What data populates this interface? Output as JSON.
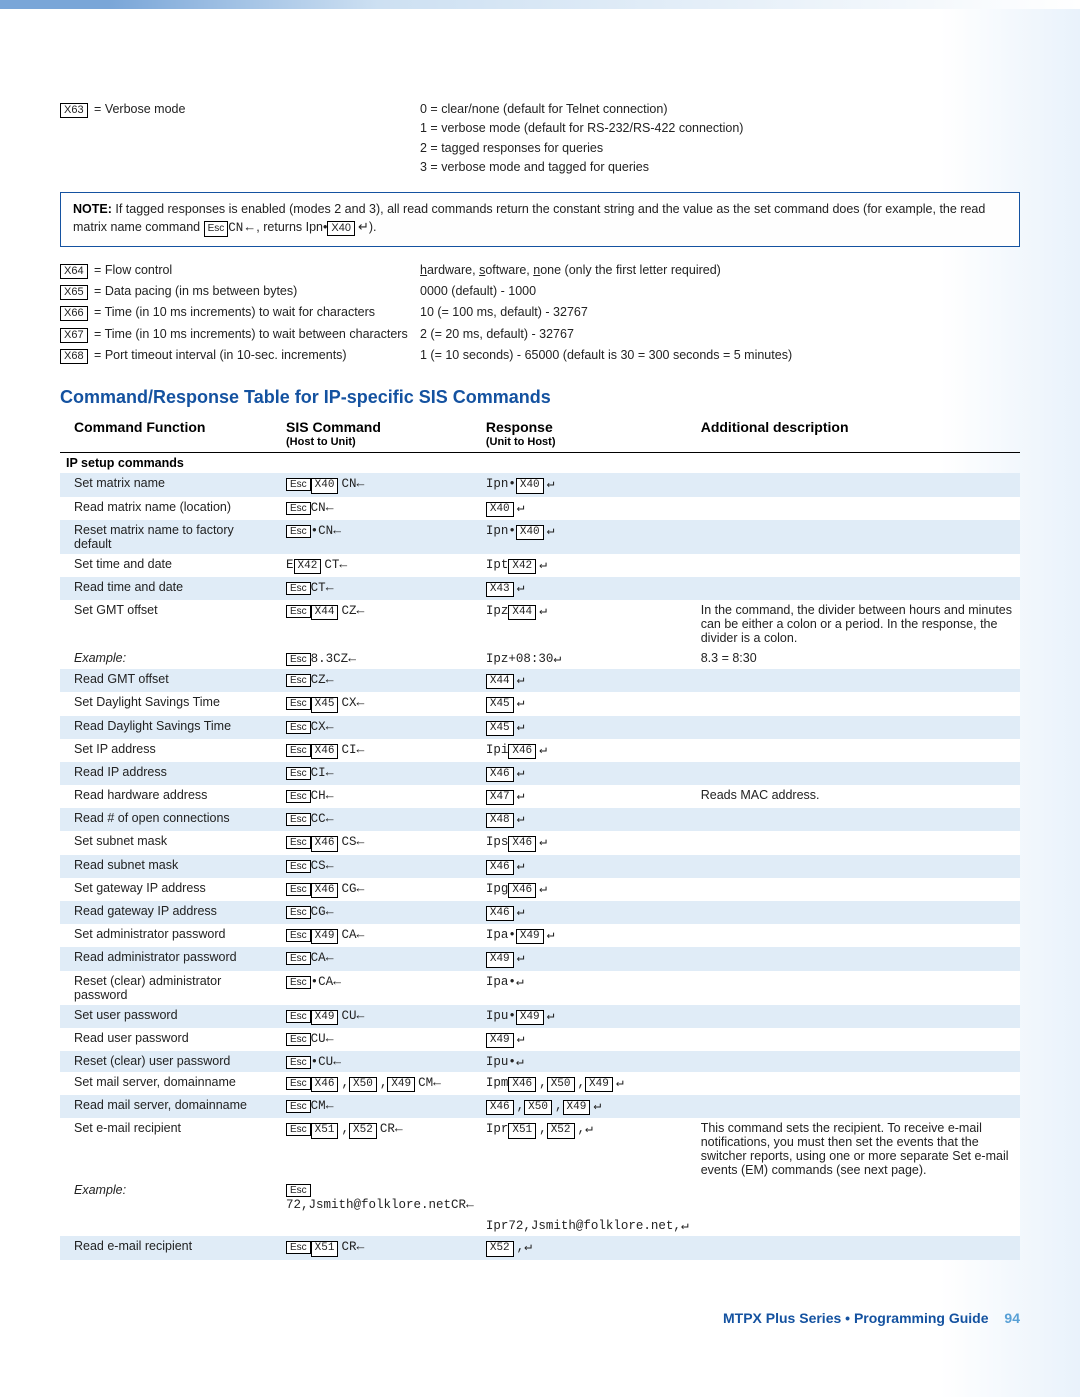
{
  "vars_top": {
    "x63": {
      "code": "X63",
      "label": "Verbose mode",
      "right": [
        "0 = clear/none (default for Telnet connection)",
        "1 = verbose mode (default for RS-232/RS-422 connection)",
        "2 = tagged responses for queries",
        "3 = verbose mode and tagged for queries"
      ]
    }
  },
  "note": {
    "label": "NOTE:",
    "prefix": "If tagged responses is enabled (modes 2 and 3), all read commands return the constant string and the value as the set command does (for example, the read matrix name command ",
    "mid_cmd": "CN",
    "mid2": ", returns Ipn•",
    "x40": "X40",
    "suffix": ")."
  },
  "vars_bottom": [
    {
      "code": "X64",
      "label": "Flow control",
      "right": "hardware, software, none (only the first letter required)",
      "uline": [
        "h",
        "s",
        "n"
      ]
    },
    {
      "code": "X65",
      "label": "Data pacing (in ms between bytes)",
      "right": "0000 (default) - 1000"
    },
    {
      "code": "X66",
      "label": "Time (in 10 ms increments) to wait for characters",
      "right": "10 (= 100 ms, default) - 32767"
    },
    {
      "code": "X67",
      "label": "Time (in 10 ms increments) to wait between characters",
      "right": "2 (= 20 ms, default) - 32767"
    },
    {
      "code": "X68",
      "label": "Port timeout interval (in 10-sec. increments)",
      "right": "1 (= 10 seconds) - 65000 (default is 30 = 300 seconds = 5 minutes)"
    }
  ],
  "section_title": "Command/Response Table for IP-specific SIS Commands",
  "headers": {
    "c1": "Command Function",
    "c2": "SIS Command",
    "c2s": "(Host to Unit)",
    "c3": "Response",
    "c3s": "(Unit to Host)",
    "c4": "Additional description"
  },
  "group_header": "IP setup commands",
  "rows": [
    {
      "alt": true,
      "func": "Set matrix name",
      "sis": {
        "parts": [
          {
            "esc": true
          },
          {
            "x": "X40"
          },
          {
            "t": "CN"
          },
          {
            "left": true
          }
        ]
      },
      "resp": {
        "parts": [
          {
            "t": "Ipn•"
          },
          {
            "x": "X40"
          },
          {
            "ent": true
          }
        ]
      },
      "desc": ""
    },
    {
      "alt": false,
      "func": "Read matrix name (location)",
      "sis": {
        "parts": [
          {
            "esc": true
          },
          {
            "t": "CN"
          },
          {
            "left": true
          }
        ]
      },
      "resp": {
        "parts": [
          {
            "x": "X40"
          },
          {
            "ent": true
          }
        ]
      },
      "desc": ""
    },
    {
      "alt": true,
      "func": "Reset matrix name to factory default",
      "sis": {
        "parts": [
          {
            "esc": true
          },
          {
            "t": "•CN"
          },
          {
            "left": true
          }
        ]
      },
      "resp": {
        "parts": [
          {
            "t": "Ipn•"
          },
          {
            "x": "X40"
          },
          {
            "ent": true
          }
        ]
      },
      "desc": ""
    },
    {
      "alt": false,
      "func": "Set time and date",
      "sis": {
        "parts": [
          {
            "t": "E"
          },
          {
            "x": "X42"
          },
          {
            "t": "CT"
          },
          {
            "left": true
          }
        ]
      },
      "resp": {
        "parts": [
          {
            "t": "Ipt"
          },
          {
            "x": "X42"
          },
          {
            "ent": true
          }
        ]
      },
      "desc": ""
    },
    {
      "alt": true,
      "func": "Read time and date",
      "sis": {
        "parts": [
          {
            "esc": true
          },
          {
            "t": "CT"
          },
          {
            "left": true
          }
        ]
      },
      "resp": {
        "parts": [
          {
            "x": "X43"
          },
          {
            "ent": true
          }
        ]
      },
      "desc": ""
    },
    {
      "alt": false,
      "func": "Set GMT offset",
      "sis": {
        "parts": [
          {
            "esc": true
          },
          {
            "x": "X44"
          },
          {
            "t": "CZ"
          },
          {
            "left": true
          }
        ]
      },
      "resp": {
        "parts": [
          {
            "t": "Ipz"
          },
          {
            "x": "X44"
          },
          {
            "ent": true
          }
        ]
      },
      "desc": "In the command, the divider between hours and minutes can be either a colon or a period. In the response, the divider is a colon."
    },
    {
      "alt": false,
      "italic": true,
      "func": "Example:",
      "sis": {
        "parts": [
          {
            "esc": true
          },
          {
            "t": "8.3CZ"
          },
          {
            "left": true
          }
        ]
      },
      "resp": {
        "parts": [
          {
            "t": "Ipz+08:30"
          },
          {
            "ent": true
          }
        ]
      },
      "desc": "8.3 = 8:30"
    },
    {
      "alt": true,
      "func": "Read GMT offset",
      "sis": {
        "parts": [
          {
            "esc": true
          },
          {
            "t": "CZ"
          },
          {
            "left": true
          }
        ]
      },
      "resp": {
        "parts": [
          {
            "x": "X44"
          },
          {
            "ent": true
          }
        ]
      },
      "desc": ""
    },
    {
      "alt": false,
      "func": "Set Daylight Savings Time",
      "sis": {
        "parts": [
          {
            "esc": true
          },
          {
            "x": "X45"
          },
          {
            "t": "CX"
          },
          {
            "left": true
          }
        ]
      },
      "resp": {
        "parts": [
          {
            "x": "X45"
          },
          {
            "ent": true
          }
        ]
      },
      "desc": ""
    },
    {
      "alt": true,
      "func": "Read Daylight Savings Time",
      "sis": {
        "parts": [
          {
            "esc": true
          },
          {
            "t": "CX"
          },
          {
            "left": true
          }
        ]
      },
      "resp": {
        "parts": [
          {
            "x": "X45"
          },
          {
            "ent": true
          }
        ]
      },
      "desc": ""
    },
    {
      "alt": false,
      "func": "Set IP address",
      "sis": {
        "parts": [
          {
            "esc": true
          },
          {
            "x": "X46"
          },
          {
            "t": "CI"
          },
          {
            "left": true
          }
        ]
      },
      "resp": {
        "parts": [
          {
            "t": "Ipi"
          },
          {
            "x": "X46"
          },
          {
            "ent": true
          }
        ]
      },
      "desc": ""
    },
    {
      "alt": true,
      "func": "Read IP address",
      "sis": {
        "parts": [
          {
            "esc": true
          },
          {
            "t": "CI"
          },
          {
            "left": true
          }
        ]
      },
      "resp": {
        "parts": [
          {
            "x": "X46"
          },
          {
            "ent": true
          }
        ]
      },
      "desc": ""
    },
    {
      "alt": false,
      "func": "Read hardware address",
      "sis": {
        "parts": [
          {
            "esc": true
          },
          {
            "t": "CH"
          },
          {
            "left": true
          }
        ]
      },
      "resp": {
        "parts": [
          {
            "x": "X47"
          },
          {
            "ent": true
          }
        ]
      },
      "desc": "Reads MAC address."
    },
    {
      "alt": true,
      "func": "Read # of open connections",
      "sis": {
        "parts": [
          {
            "esc": true
          },
          {
            "t": "CC"
          },
          {
            "left": true
          }
        ]
      },
      "resp": {
        "parts": [
          {
            "x": "X48"
          },
          {
            "ent": true
          }
        ]
      },
      "desc": ""
    },
    {
      "alt": false,
      "func": "Set subnet mask",
      "sis": {
        "parts": [
          {
            "esc": true
          },
          {
            "x": "X46"
          },
          {
            "t": "CS"
          },
          {
            "left": true
          }
        ]
      },
      "resp": {
        "parts": [
          {
            "t": "Ips"
          },
          {
            "x": "X46"
          },
          {
            "ent": true
          }
        ]
      },
      "desc": ""
    },
    {
      "alt": true,
      "func": "Read subnet mask",
      "sis": {
        "parts": [
          {
            "esc": true
          },
          {
            "t": "CS"
          },
          {
            "left": true
          }
        ]
      },
      "resp": {
        "parts": [
          {
            "x": "X46"
          },
          {
            "ent": true
          }
        ]
      },
      "desc": ""
    },
    {
      "alt": false,
      "func": "Set gateway IP address",
      "sis": {
        "parts": [
          {
            "esc": true
          },
          {
            "x": "X46"
          },
          {
            "t": "CG"
          },
          {
            "left": true
          }
        ]
      },
      "resp": {
        "parts": [
          {
            "t": "Ipg"
          },
          {
            "x": "X46"
          },
          {
            "ent": true
          }
        ]
      },
      "desc": ""
    },
    {
      "alt": true,
      "func": "Read gateway IP address",
      "sis": {
        "parts": [
          {
            "esc": true
          },
          {
            "t": "CG"
          },
          {
            "left": true
          }
        ]
      },
      "resp": {
        "parts": [
          {
            "x": "X46"
          },
          {
            "ent": true
          }
        ]
      },
      "desc": ""
    },
    {
      "alt": false,
      "func": "Set administrator password",
      "sis": {
        "parts": [
          {
            "esc": true
          },
          {
            "x": "X49"
          },
          {
            "t": "CA"
          },
          {
            "left": true
          }
        ]
      },
      "resp": {
        "parts": [
          {
            "t": "Ipa•"
          },
          {
            "x": "X49"
          },
          {
            "ent": true
          }
        ]
      },
      "desc": ""
    },
    {
      "alt": true,
      "func": "Read administrator password",
      "sis": {
        "parts": [
          {
            "esc": true
          },
          {
            "t": "CA"
          },
          {
            "left": true
          }
        ]
      },
      "resp": {
        "parts": [
          {
            "x": "X49"
          },
          {
            "ent": true
          }
        ]
      },
      "desc": ""
    },
    {
      "alt": false,
      "func": "Reset (clear) administrator password",
      "sis": {
        "parts": [
          {
            "esc": true
          },
          {
            "t": "•CA"
          },
          {
            "left": true
          }
        ]
      },
      "resp": {
        "parts": [
          {
            "t": "Ipa•"
          },
          {
            "ent": true
          }
        ]
      },
      "desc": ""
    },
    {
      "alt": true,
      "func": "Set user password",
      "sis": {
        "parts": [
          {
            "esc": true
          },
          {
            "x": "X49"
          },
          {
            "t": "CU"
          },
          {
            "left": true
          }
        ]
      },
      "resp": {
        "parts": [
          {
            "t": "Ipu•"
          },
          {
            "x": "X49"
          },
          {
            "ent": true
          }
        ]
      },
      "desc": ""
    },
    {
      "alt": false,
      "func": "Read user password",
      "sis": {
        "parts": [
          {
            "esc": true
          },
          {
            "t": "CU"
          },
          {
            "left": true
          }
        ]
      },
      "resp": {
        "parts": [
          {
            "x": "X49"
          },
          {
            "ent": true
          }
        ]
      },
      "desc": ""
    },
    {
      "alt": true,
      "func": "Reset (clear) user password",
      "sis": {
        "parts": [
          {
            "esc": true
          },
          {
            "t": "•CU"
          },
          {
            "left": true
          }
        ]
      },
      "resp": {
        "parts": [
          {
            "t": "Ipu•"
          },
          {
            "ent": true
          }
        ]
      },
      "desc": ""
    },
    {
      "alt": false,
      "func": "Set mail server, domainname",
      "sis": {
        "parts": [
          {
            "esc": true
          },
          {
            "x": "X46"
          },
          {
            "t": ","
          },
          {
            "x": "X50"
          },
          {
            "t": ","
          },
          {
            "x": "X49"
          },
          {
            "t": "CM"
          },
          {
            "left": true
          }
        ]
      },
      "resp": {
        "parts": [
          {
            "t": "Ipm"
          },
          {
            "x": "X46"
          },
          {
            "t": ","
          },
          {
            "x": "X50"
          },
          {
            "t": ","
          },
          {
            "x": "X49"
          },
          {
            "ent": true
          }
        ]
      },
      "desc": ""
    },
    {
      "alt": true,
      "func": "Read mail server, domainname",
      "sis": {
        "parts": [
          {
            "esc": true
          },
          {
            "t": "CM"
          },
          {
            "left": true
          }
        ]
      },
      "resp": {
        "parts": [
          {
            "x": "X46"
          },
          {
            "t": ","
          },
          {
            "x": "X50"
          },
          {
            "t": ","
          },
          {
            "x": "X49"
          },
          {
            "ent": true
          }
        ]
      },
      "desc": ""
    },
    {
      "alt": false,
      "func": "Set e-mail recipient",
      "sis": {
        "parts": [
          {
            "esc": true
          },
          {
            "x": "X51"
          },
          {
            "t": ","
          },
          {
            "x": "X52"
          },
          {
            "t": "CR"
          },
          {
            "left": true
          }
        ]
      },
      "resp": {
        "parts": [
          {
            "t": "Ipr"
          },
          {
            "x": "X51"
          },
          {
            "t": ","
          },
          {
            "x": "X52"
          },
          {
            "t": ","
          },
          {
            "ent": true
          }
        ]
      },
      "desc": "This command sets the recipient. To receive e-mail notifications, you must then set the events that the switcher reports, using one or more separate Set e-mail events (EM) commands (see next page)."
    },
    {
      "alt": false,
      "italic": true,
      "func": "Example:",
      "sis": {
        "parts": [
          {
            "esc": true
          },
          {
            "t": "72,Jsmith@folklore.netCR"
          },
          {
            "left": true
          }
        ]
      },
      "resp": {
        "parts": []
      },
      "desc": ""
    },
    {
      "alt": false,
      "func": "",
      "sis": {
        "parts": []
      },
      "resp": {
        "parts": [
          {
            "t": "Ipr72,Jsmith@folklore.net,"
          },
          {
            "ent": true
          }
        ]
      },
      "desc": ""
    },
    {
      "alt": true,
      "func": "Read e-mail recipient",
      "sis": {
        "parts": [
          {
            "esc": true
          },
          {
            "x": "X51"
          },
          {
            "t": "CR"
          },
          {
            "left": true
          }
        ]
      },
      "resp": {
        "parts": [
          {
            "x": "X52"
          },
          {
            "t": ","
          },
          {
            "ent": true
          }
        ]
      },
      "desc": ""
    }
  ],
  "footer": {
    "title": "MTPX Plus Series • Programming Guide",
    "page": "94"
  },
  "esc_label": "Esc"
}
